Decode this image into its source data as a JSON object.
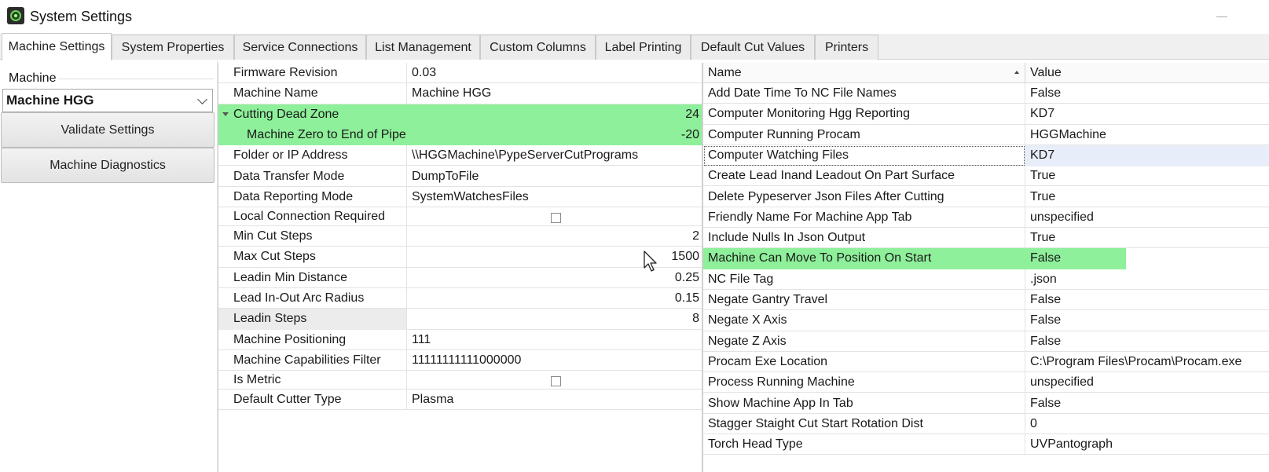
{
  "window": {
    "title": "System Settings",
    "icon": "app-disc-icon"
  },
  "tabs": [
    {
      "label": "Machine Settings",
      "active": true
    },
    {
      "label": "System Properties",
      "active": false
    },
    {
      "label": "Service Connections",
      "active": false
    },
    {
      "label": "List Management",
      "active": false
    },
    {
      "label": "Custom Columns",
      "active": false
    },
    {
      "label": "Label Printing",
      "active": false
    },
    {
      "label": "Default Cut Values",
      "active": false
    },
    {
      "label": "Printers",
      "active": false
    }
  ],
  "left_panel": {
    "group_label": "Machine",
    "selected_machine": "Machine HGG",
    "validate_button": "Validate Settings",
    "diagnostics_button": "Machine Diagnostics"
  },
  "machine_properties": [
    {
      "name": "Firmware Revision",
      "value": "0.03"
    },
    {
      "name": "Machine Name",
      "value": "Machine HGG"
    },
    {
      "name": "Cutting Dead Zone",
      "value": "24",
      "highlighted": true,
      "expanded": true
    },
    {
      "name": "Machine Zero to End of Pipe",
      "value": "-20",
      "highlighted": true,
      "child": true
    },
    {
      "name": "Folder or IP Address",
      "value": "\\\\HGGMachine\\PypeServerCutPrograms"
    },
    {
      "name": "Data Transfer Mode",
      "value": "DumpToFile"
    },
    {
      "name": "Data Reporting Mode",
      "value": "SystemWatchesFiles"
    },
    {
      "name": "Local Connection Required",
      "value": "",
      "checkbox": true,
      "checked": false
    },
    {
      "name": "Min Cut Steps",
      "value": "2"
    },
    {
      "name": "Max Cut Steps",
      "value": "1500"
    },
    {
      "name": "Leadin Min Distance",
      "value": "0.25"
    },
    {
      "name": "Lead In-Out Arc Radius",
      "value": "0.15"
    },
    {
      "name": "Leadin Steps",
      "value": "8"
    },
    {
      "name": "Machine Positioning",
      "value": "111"
    },
    {
      "name": "Machine Capabilities Filter",
      "value": "11111111111000000"
    },
    {
      "name": "Is Metric",
      "value": "",
      "checkbox": true,
      "checked": false
    },
    {
      "name": "Default Cutter Type",
      "value": "Plasma"
    }
  ],
  "system_properties": {
    "columns": {
      "name": "Name",
      "value": "Value"
    },
    "sort": "ascending",
    "rows": [
      {
        "name": "Add Date Time To NC File Names",
        "value": "False"
      },
      {
        "name": "Computer Monitoring Hgg Reporting",
        "value": "KD7"
      },
      {
        "name": "Computer Running Procam",
        "value": "HGGMachine"
      },
      {
        "name": "Computer Watching Files",
        "value": "KD7",
        "selected": true
      },
      {
        "name": "Create Lead Inand Leadout On Part Surface",
        "value": "True"
      },
      {
        "name": "Delete Pypeserver Json Files After Cutting",
        "value": "True"
      },
      {
        "name": "Friendly Name For Machine App Tab",
        "value": "unspecified"
      },
      {
        "name": "Include Nulls In Json Output",
        "value": "True"
      },
      {
        "name": "Machine Can Move To Position On Start",
        "value": "False",
        "highlighted": true
      },
      {
        "name": "NC File Tag",
        "value": ".json"
      },
      {
        "name": "Negate Gantry Travel",
        "value": "False"
      },
      {
        "name": "Negate X Axis",
        "value": "False"
      },
      {
        "name": "Negate Z Axis",
        "value": "False"
      },
      {
        "name": "Procam Exe Location",
        "value": "C:\\Program Files\\Procam\\Procam.exe"
      },
      {
        "name": "Process Running Machine",
        "value": "unspecified"
      },
      {
        "name": "Show Machine App In Tab",
        "value": "False"
      },
      {
        "name": "Stagger Staight Cut Start Rotation Dist",
        "value": "0"
      },
      {
        "name": "Torch Head Type",
        "value": "UVPantograph"
      }
    ]
  },
  "colors": {
    "highlight": "#8ef09a",
    "selection": "#e8eef9"
  }
}
